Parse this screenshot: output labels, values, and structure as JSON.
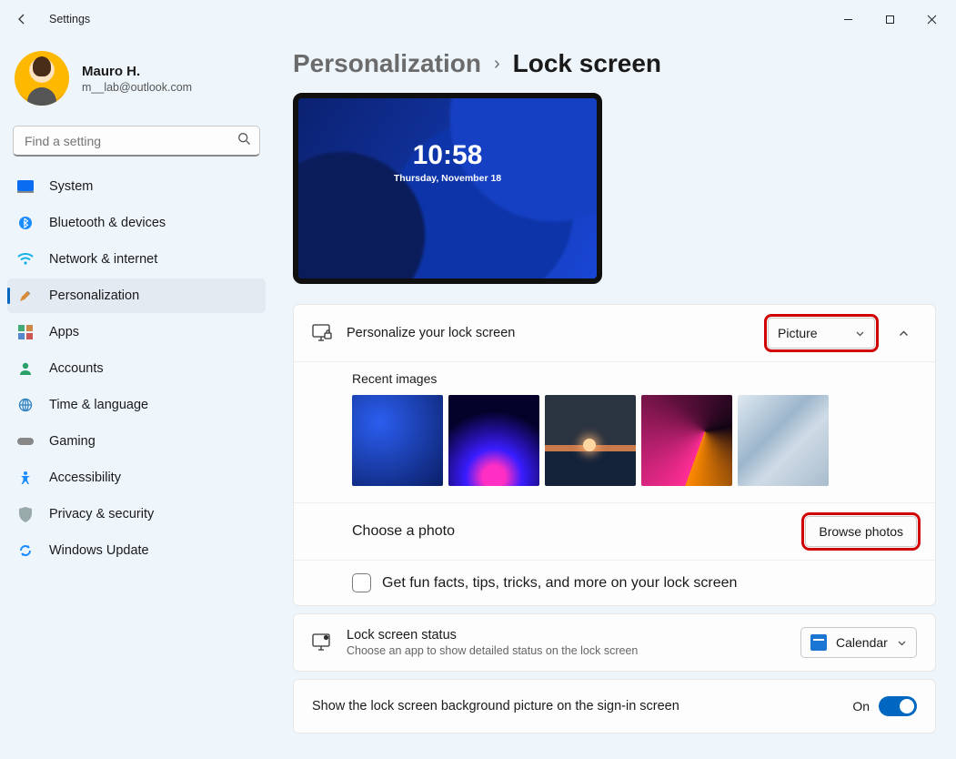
{
  "app_title": "Settings",
  "user": {
    "name": "Mauro H.",
    "email": "m__lab@outlook.com"
  },
  "search": {
    "placeholder": "Find a setting"
  },
  "nav": [
    {
      "label": "System"
    },
    {
      "label": "Bluetooth & devices"
    },
    {
      "label": "Network & internet"
    },
    {
      "label": "Personalization",
      "active": true
    },
    {
      "label": "Apps"
    },
    {
      "label": "Accounts"
    },
    {
      "label": "Time & language"
    },
    {
      "label": "Gaming"
    },
    {
      "label": "Accessibility"
    },
    {
      "label": "Privacy & security"
    },
    {
      "label": "Windows Update"
    }
  ],
  "breadcrumb": {
    "parent": "Personalization",
    "current": "Lock screen"
  },
  "preview": {
    "time": "10:58",
    "date": "Thursday, November 18"
  },
  "personalize": {
    "title": "Personalize your lock screen",
    "dropdown_value": "Picture",
    "recent_label": "Recent images",
    "choose_label": "Choose a photo",
    "browse_label": "Browse photos",
    "fun_facts_label": "Get fun facts, tips, tricks, and more on your lock screen",
    "fun_facts_checked": false
  },
  "status": {
    "title": "Lock screen status",
    "subtitle": "Choose an app to show detailed status on the lock screen",
    "app_value": "Calendar"
  },
  "signin": {
    "label": "Show the lock screen background picture on the sign-in screen",
    "state_text": "On",
    "on": true
  }
}
